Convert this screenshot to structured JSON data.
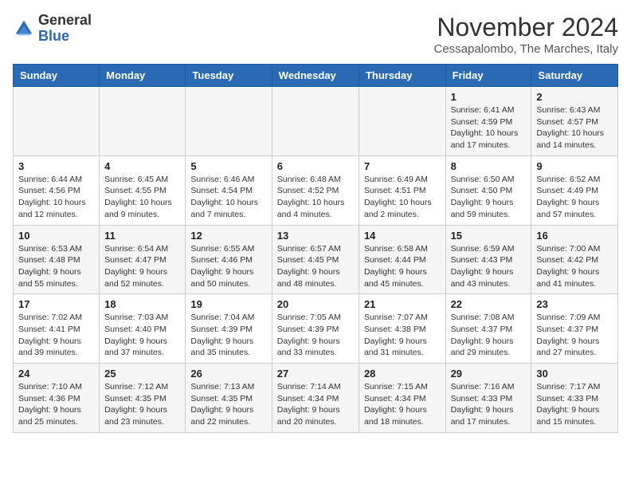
{
  "header": {
    "logo": {
      "line1": "General",
      "line2": "Blue"
    },
    "month": "November 2024",
    "location": "Cessapalombo, The Marches, Italy"
  },
  "weekdays": [
    "Sunday",
    "Monday",
    "Tuesday",
    "Wednesday",
    "Thursday",
    "Friday",
    "Saturday"
  ],
  "weeks": [
    [
      {
        "day": "",
        "info": ""
      },
      {
        "day": "",
        "info": ""
      },
      {
        "day": "",
        "info": ""
      },
      {
        "day": "",
        "info": ""
      },
      {
        "day": "",
        "info": ""
      },
      {
        "day": "1",
        "info": "Sunrise: 6:41 AM\nSunset: 4:59 PM\nDaylight: 10 hours and 17 minutes."
      },
      {
        "day": "2",
        "info": "Sunrise: 6:43 AM\nSunset: 4:57 PM\nDaylight: 10 hours and 14 minutes."
      }
    ],
    [
      {
        "day": "3",
        "info": "Sunrise: 6:44 AM\nSunset: 4:56 PM\nDaylight: 10 hours and 12 minutes."
      },
      {
        "day": "4",
        "info": "Sunrise: 6:45 AM\nSunset: 4:55 PM\nDaylight: 10 hours and 9 minutes."
      },
      {
        "day": "5",
        "info": "Sunrise: 6:46 AM\nSunset: 4:54 PM\nDaylight: 10 hours and 7 minutes."
      },
      {
        "day": "6",
        "info": "Sunrise: 6:48 AM\nSunset: 4:52 PM\nDaylight: 10 hours and 4 minutes."
      },
      {
        "day": "7",
        "info": "Sunrise: 6:49 AM\nSunset: 4:51 PM\nDaylight: 10 hours and 2 minutes."
      },
      {
        "day": "8",
        "info": "Sunrise: 6:50 AM\nSunset: 4:50 PM\nDaylight: 9 hours and 59 minutes."
      },
      {
        "day": "9",
        "info": "Sunrise: 6:52 AM\nSunset: 4:49 PM\nDaylight: 9 hours and 57 minutes."
      }
    ],
    [
      {
        "day": "10",
        "info": "Sunrise: 6:53 AM\nSunset: 4:48 PM\nDaylight: 9 hours and 55 minutes."
      },
      {
        "day": "11",
        "info": "Sunrise: 6:54 AM\nSunset: 4:47 PM\nDaylight: 9 hours and 52 minutes."
      },
      {
        "day": "12",
        "info": "Sunrise: 6:55 AM\nSunset: 4:46 PM\nDaylight: 9 hours and 50 minutes."
      },
      {
        "day": "13",
        "info": "Sunrise: 6:57 AM\nSunset: 4:45 PM\nDaylight: 9 hours and 48 minutes."
      },
      {
        "day": "14",
        "info": "Sunrise: 6:58 AM\nSunset: 4:44 PM\nDaylight: 9 hours and 45 minutes."
      },
      {
        "day": "15",
        "info": "Sunrise: 6:59 AM\nSunset: 4:43 PM\nDaylight: 9 hours and 43 minutes."
      },
      {
        "day": "16",
        "info": "Sunrise: 7:00 AM\nSunset: 4:42 PM\nDaylight: 9 hours and 41 minutes."
      }
    ],
    [
      {
        "day": "17",
        "info": "Sunrise: 7:02 AM\nSunset: 4:41 PM\nDaylight: 9 hours and 39 minutes."
      },
      {
        "day": "18",
        "info": "Sunrise: 7:03 AM\nSunset: 4:40 PM\nDaylight: 9 hours and 37 minutes."
      },
      {
        "day": "19",
        "info": "Sunrise: 7:04 AM\nSunset: 4:39 PM\nDaylight: 9 hours and 35 minutes."
      },
      {
        "day": "20",
        "info": "Sunrise: 7:05 AM\nSunset: 4:39 PM\nDaylight: 9 hours and 33 minutes."
      },
      {
        "day": "21",
        "info": "Sunrise: 7:07 AM\nSunset: 4:38 PM\nDaylight: 9 hours and 31 minutes."
      },
      {
        "day": "22",
        "info": "Sunrise: 7:08 AM\nSunset: 4:37 PM\nDaylight: 9 hours and 29 minutes."
      },
      {
        "day": "23",
        "info": "Sunrise: 7:09 AM\nSunset: 4:37 PM\nDaylight: 9 hours and 27 minutes."
      }
    ],
    [
      {
        "day": "24",
        "info": "Sunrise: 7:10 AM\nSunset: 4:36 PM\nDaylight: 9 hours and 25 minutes."
      },
      {
        "day": "25",
        "info": "Sunrise: 7:12 AM\nSunset: 4:35 PM\nDaylight: 9 hours and 23 minutes."
      },
      {
        "day": "26",
        "info": "Sunrise: 7:13 AM\nSunset: 4:35 PM\nDaylight: 9 hours and 22 minutes."
      },
      {
        "day": "27",
        "info": "Sunrise: 7:14 AM\nSunset: 4:34 PM\nDaylight: 9 hours and 20 minutes."
      },
      {
        "day": "28",
        "info": "Sunrise: 7:15 AM\nSunset: 4:34 PM\nDaylight: 9 hours and 18 minutes."
      },
      {
        "day": "29",
        "info": "Sunrise: 7:16 AM\nSunset: 4:33 PM\nDaylight: 9 hours and 17 minutes."
      },
      {
        "day": "30",
        "info": "Sunrise: 7:17 AM\nSunset: 4:33 PM\nDaylight: 9 hours and 15 minutes."
      }
    ]
  ]
}
